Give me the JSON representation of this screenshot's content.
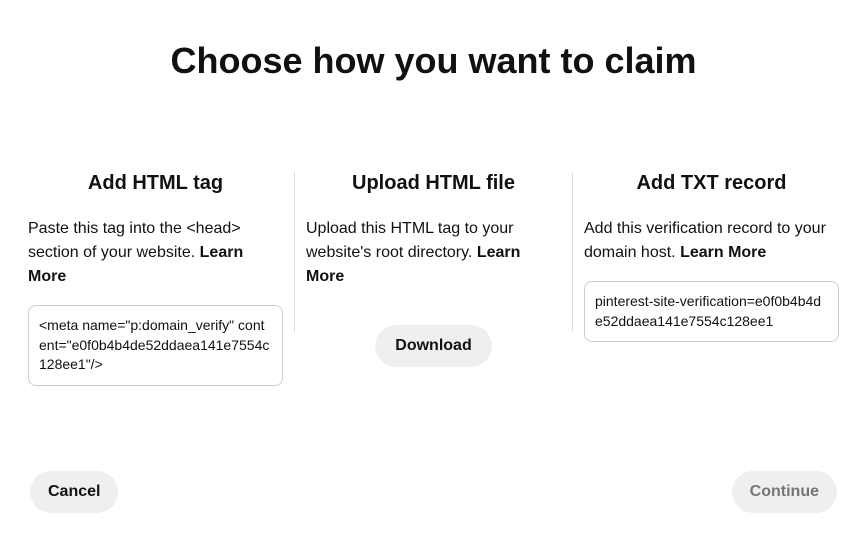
{
  "title": "Choose how you want to claim",
  "options": {
    "html_tag": {
      "title": "Add HTML tag",
      "desc": "Paste this tag into the <head> section of your website.",
      "learn_more": "Learn More",
      "code": "<meta name=\"p:domain_verify\" content=\"e0f0b4b4de52ddaea141e7554c128ee1\"/>"
    },
    "html_file": {
      "title": "Upload HTML file",
      "desc": "Upload this HTML tag to your website's root directory.",
      "learn_more": "Learn More",
      "button": "Download"
    },
    "txt_record": {
      "title": "Add TXT record",
      "desc": "Add this verification record to your domain host.",
      "learn_more": "Learn More",
      "code": "pinterest-site-verification=e0f0b4b4de52ddaea141e7554c128ee1"
    }
  },
  "footer": {
    "cancel": "Cancel",
    "continue": "Continue"
  }
}
